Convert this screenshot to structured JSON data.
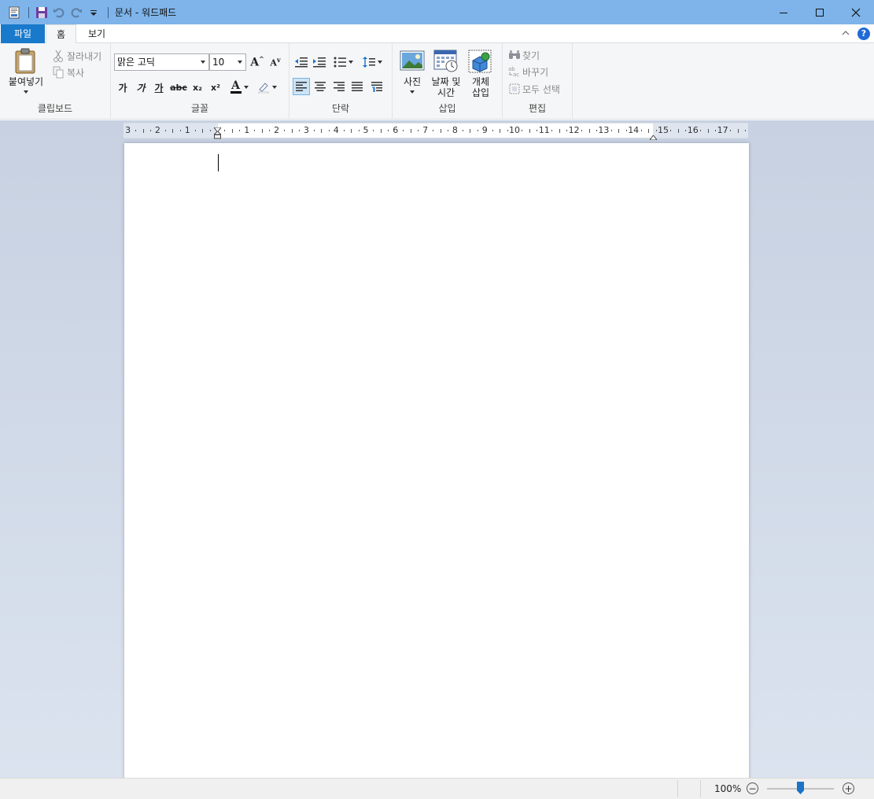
{
  "window": {
    "title": "문서 - 워드패드",
    "controls": [
      "minimize",
      "maximize",
      "close"
    ]
  },
  "tabs": [
    {
      "label": "파일",
      "active": false
    },
    {
      "label": "홈",
      "active": true
    },
    {
      "label": "보기",
      "active": false
    }
  ],
  "help_label": "?",
  "ribbon": {
    "clipboard": {
      "label": "클립보드",
      "paste": "붙여넣기",
      "cut": "잘라내기",
      "copy": "복사"
    },
    "font": {
      "label": "글꼴",
      "family": "맑은 고딕",
      "size": "10",
      "bold": "가",
      "italic": "가",
      "underline": "가",
      "strike": "abc",
      "subscript": "x₂",
      "superscript": "x²",
      "font_color_glyph": "A",
      "font_color": "#000000",
      "highlight_color": "#ffffff"
    },
    "paragraph": {
      "label": "단락"
    },
    "insert": {
      "label": "삽입",
      "picture": "사진",
      "datetime_line1": "날짜 및",
      "datetime_line2": "시간",
      "object_line1": "개체",
      "object_line2": "삽입"
    },
    "editing": {
      "label": "편집",
      "find": "찾기",
      "replace": "바꾸기",
      "select_all": "모두 선택"
    }
  },
  "ruler": {
    "left_numbers": [
      "3",
      "2",
      "1"
    ],
    "right_numbers": [
      "1",
      "2",
      "3",
      "4",
      "5",
      "6",
      "7",
      "8",
      "9",
      "10",
      "11",
      "12",
      "13",
      "14",
      "15",
      "16",
      "17"
    ]
  },
  "status": {
    "zoom": "100%",
    "zoom_fraction": 0.5
  },
  "colors": {
    "titlebar": "#7eb4ea",
    "file_tab": "#1979ca",
    "accent": "#1a73c6"
  }
}
